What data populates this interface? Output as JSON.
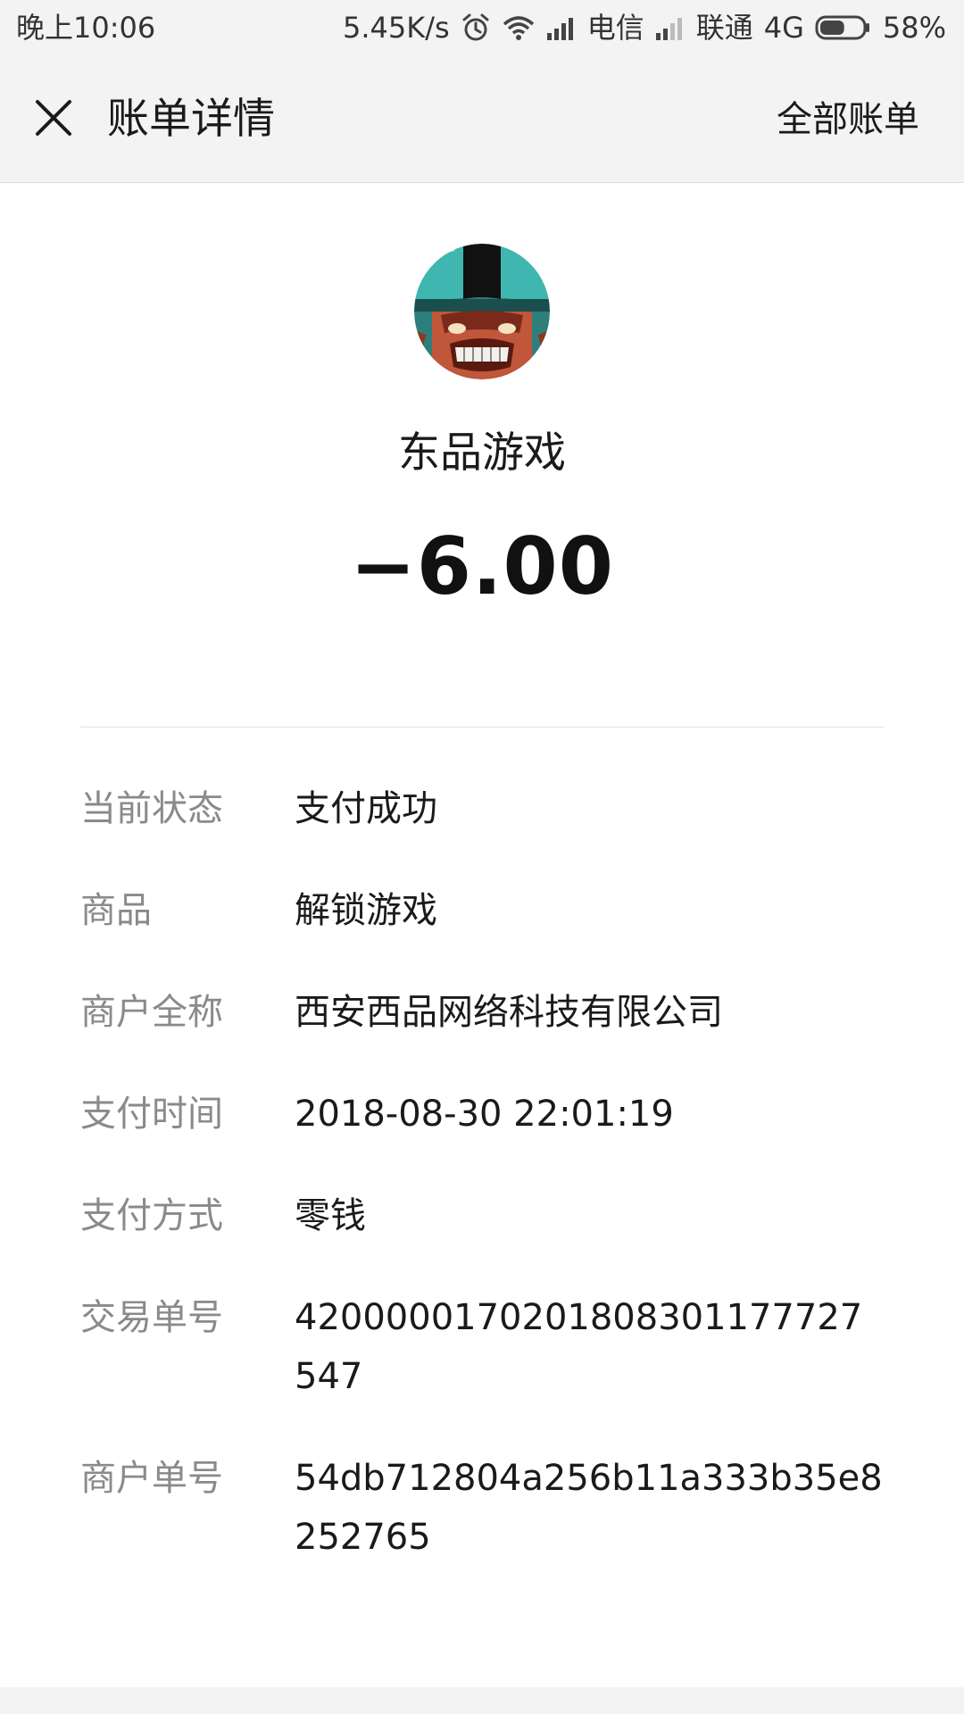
{
  "status_bar": {
    "time": "晚上10:06",
    "network_speed": "5.45K/s",
    "carrier1": "电信",
    "carrier2": "联通",
    "network_type": "4G",
    "battery_percent": "58%",
    "battery_level": 0.58,
    "icons": [
      "alarm-icon",
      "wifi-icon",
      "signal-icon",
      "battery-icon"
    ]
  },
  "header": {
    "title": "账单详情",
    "all_bills": "全部账单",
    "close_icon": "close-icon"
  },
  "summary": {
    "merchant_name": "东品游戏",
    "amount": "−6.00",
    "avatar": "game-character-avatar"
  },
  "details": [
    {
      "label": "当前状态",
      "value": "支付成功"
    },
    {
      "label": "商品",
      "value": "解锁游戏"
    },
    {
      "label": "商户全称",
      "value": "西安西品网络科技有限公司"
    },
    {
      "label": "支付时间",
      "value": "2018-08-30 22:01:19"
    },
    {
      "label": "支付方式",
      "value": "零钱"
    },
    {
      "label": "交易单号",
      "value": "4200000170201808301177727547"
    },
    {
      "label": "商户单号",
      "value": "54db712804a256b11a333b35e8252765"
    }
  ],
  "colors": {
    "background": "#f3f3f3",
    "card": "#ffffff",
    "label_gray": "#8a8a8a",
    "text": "#1a1a1a"
  }
}
